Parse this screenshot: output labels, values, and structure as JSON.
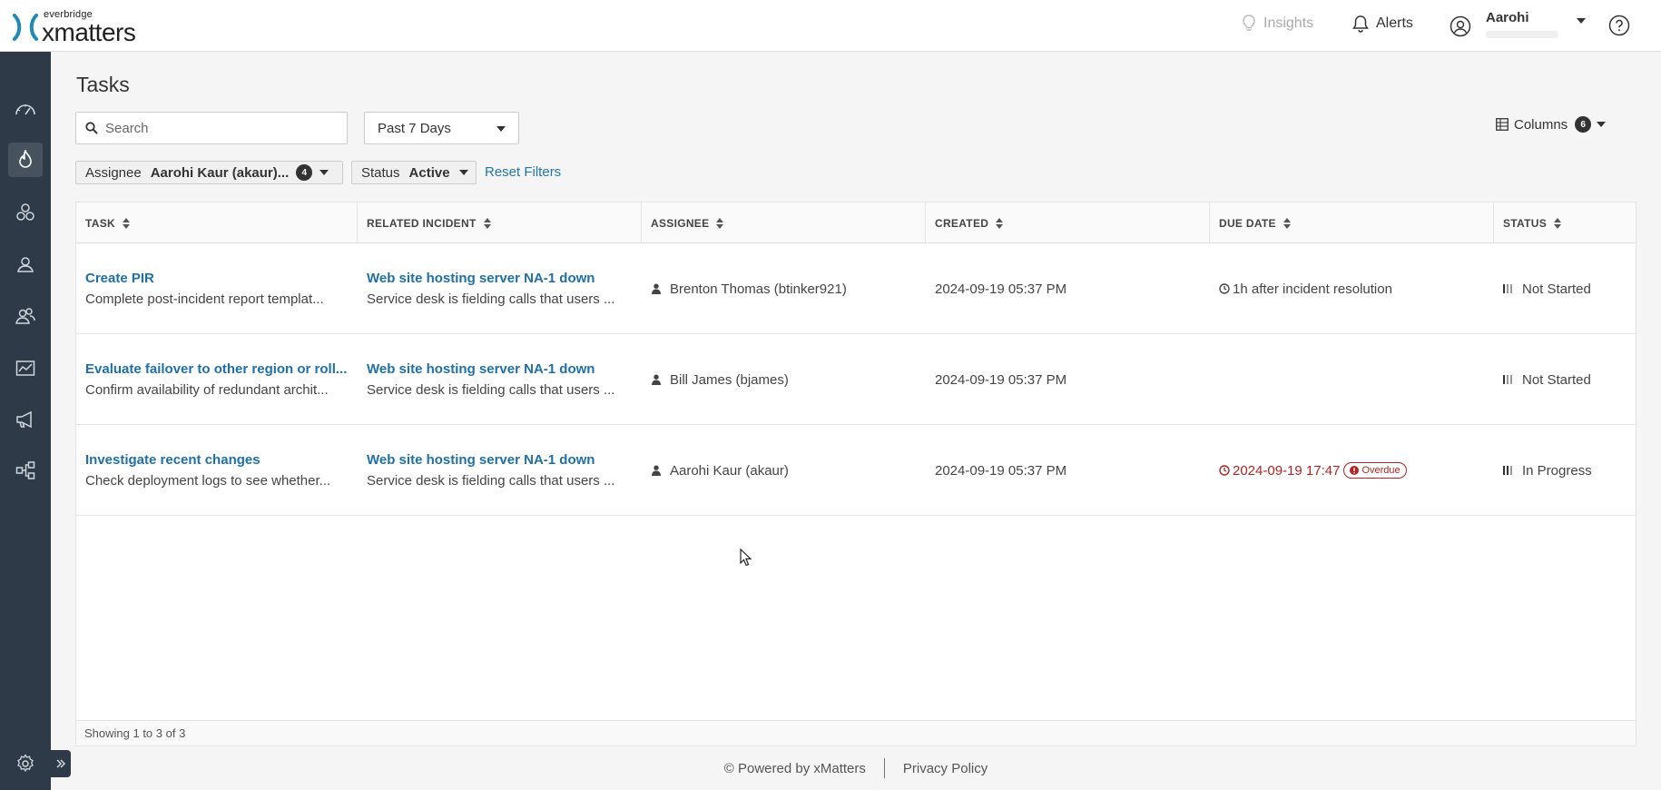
{
  "header": {
    "logo_small": "everbridge",
    "logo_main": "xmatters",
    "insights": "Insights",
    "alerts": "Alerts",
    "user_name": "Aarohi"
  },
  "sidebar": {
    "items": [
      {
        "icon": "dashboard-icon"
      },
      {
        "icon": "incidents-flame-icon",
        "active": true
      },
      {
        "icon": "services-icon"
      },
      {
        "icon": "user-icon"
      },
      {
        "icon": "groups-icon"
      },
      {
        "icon": "reports-icon"
      },
      {
        "icon": "messaging-megaphone-icon"
      },
      {
        "icon": "workflows-icon"
      }
    ],
    "bottom_icon": "settings-gear-icon"
  },
  "page": {
    "title": "Tasks",
    "search_placeholder": "Search",
    "range_value": "Past 7 Days",
    "columns_label": "Columns",
    "columns_count": "6"
  },
  "filters": {
    "assignee_label": "Assignee",
    "assignee_value": "Aarohi Kaur (akaur)...",
    "assignee_count": "4",
    "status_label": "Status",
    "status_value": "Active",
    "reset": "Reset Filters"
  },
  "table": {
    "headers": [
      "TASK",
      "RELATED INCIDENT",
      "ASSIGNEE",
      "CREATED",
      "DUE DATE",
      "STATUS"
    ],
    "rows": [
      {
        "task": "Create PIR",
        "task_desc": "Complete post-incident report templat...",
        "incident": "Web site hosting server NA-1 down",
        "incident_desc": "Service desk is fielding calls that users ...",
        "assignee": "Brenton Thomas (btinker921)",
        "created": "2024-09-19 05:37 PM",
        "due": "1h after incident resolution",
        "overdue": "",
        "status": "Not Started"
      },
      {
        "task": "Evaluate failover to other region or roll...",
        "task_desc": "Confirm availability of redundant archit...",
        "incident": "Web site hosting server NA-1 down",
        "incident_desc": "Service desk is fielding calls that users ...",
        "assignee": "Bill James (bjames)",
        "created": "2024-09-19 05:37 PM",
        "due": "",
        "overdue": "",
        "status": "Not Started"
      },
      {
        "task": "Investigate recent changes",
        "task_desc": "Check deployment logs to see whether...",
        "incident": "Web site hosting server NA-1 down",
        "incident_desc": "Service desk is fielding calls that users ...",
        "assignee": "Aarohi Kaur (akaur)",
        "created": "2024-09-19 05:37 PM",
        "due": "2024-09-19 17:47",
        "overdue": "Overdue",
        "status": "In Progress"
      }
    ],
    "footer": "Showing 1 to 3 of 3"
  },
  "footer": {
    "powered": "© Powered by xMatters",
    "privacy": "Privacy Policy"
  },
  "colors": {
    "sidebar": "#2e3a47",
    "link": "#1f6fa8",
    "overdue": "#b22222"
  }
}
